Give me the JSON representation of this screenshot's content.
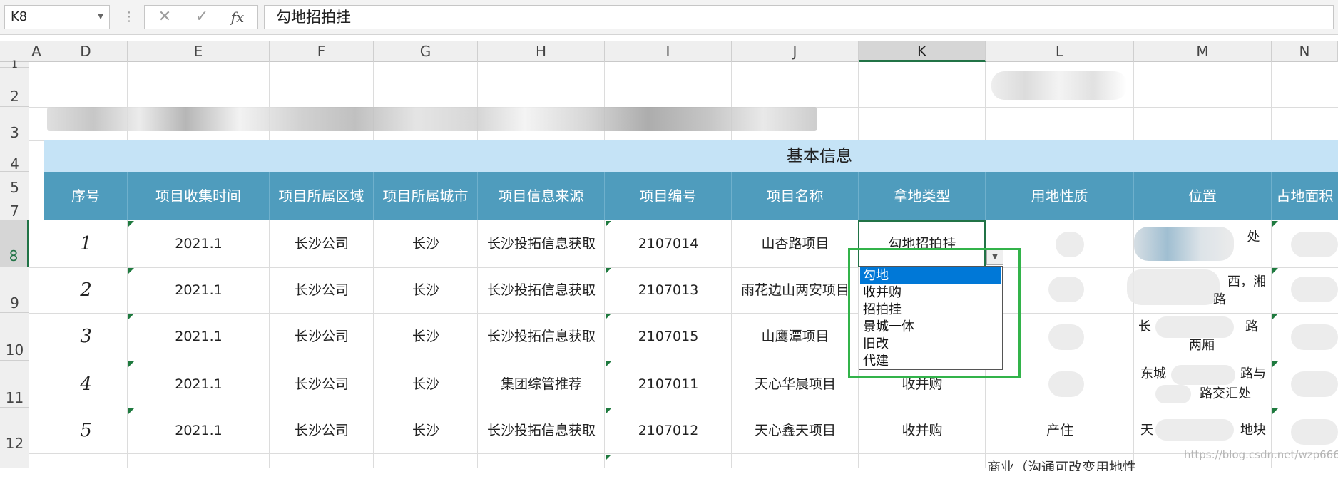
{
  "formula_bar": {
    "name_box": "K8",
    "separator": "⋮",
    "cancel_glyph": "✕",
    "enter_glyph": "✓",
    "fx_glyph": "fx",
    "content": "勾地招拍挂"
  },
  "columns": [
    "A",
    "D",
    "E",
    "F",
    "G",
    "H",
    "I",
    "J",
    "K",
    "L",
    "M",
    "N"
  ],
  "rows": [
    "1",
    "2",
    "3",
    "4",
    "5",
    "7",
    "8",
    "9",
    "10",
    "11",
    "12"
  ],
  "sheet": {
    "section_title": "基本信息",
    "headers": [
      "序号",
      "项目收集时间",
      "项目所属区域",
      "项目所属城市",
      "项目信息来源",
      "项目编号",
      "项目名称",
      "拿地类型",
      "用地性质",
      "位置",
      "占地面积"
    ],
    "data_rows": [
      [
        "1",
        "2021.1",
        "长沙公司",
        "长沙",
        "长沙投拓信息获取",
        "2107014",
        "山杏路项目",
        "勾地招拍挂"
      ],
      [
        "2",
        "2021.1",
        "长沙公司",
        "长沙",
        "长沙投拓信息获取",
        "2107013",
        "雨花边山两安项目",
        ""
      ],
      [
        "3",
        "2021.1",
        "长沙公司",
        "长沙",
        "长沙投拓信息获取",
        "2107015",
        "山鹰潭项目",
        ""
      ],
      [
        "4",
        "2021.1",
        "长沙公司",
        "长沙",
        "集团综管推荐",
        "2107011",
        "天心华晨项目",
        "收并购"
      ],
      [
        "5",
        "2021.1",
        "长沙公司",
        "长沙",
        "长沙投拓信息获取",
        "2107012",
        "天心鑫天项目",
        "收并购"
      ]
    ],
    "partial_text": {
      "l_row12": "产住",
      "m_row8": "处",
      "m_row9a": "西，湘",
      "m_row9b": "路",
      "m_row10a": "长",
      "m_row10b": "路",
      "m_row10c": "两厢",
      "m_row11a": "东城",
      "m_row11b": "路与",
      "m_row11c": "路交汇处",
      "m_row12a": "天",
      "m_row12b": "地块",
      "bottom_l": "商业（沟通可改变用地性"
    }
  },
  "dropdown": {
    "options": [
      "勾地",
      "收并购",
      "招拍挂",
      "景城一体",
      "旧改",
      "代建"
    ],
    "selected_index": 0
  },
  "watermark": "https://blog.csdn.net/wzp666",
  "colors": {
    "section_band": "#c5e3f6",
    "header_band": "#4f9cbd",
    "selection_green": "#217346",
    "highlight_frame": "#32b34a",
    "option_selected": "#0078d7"
  }
}
